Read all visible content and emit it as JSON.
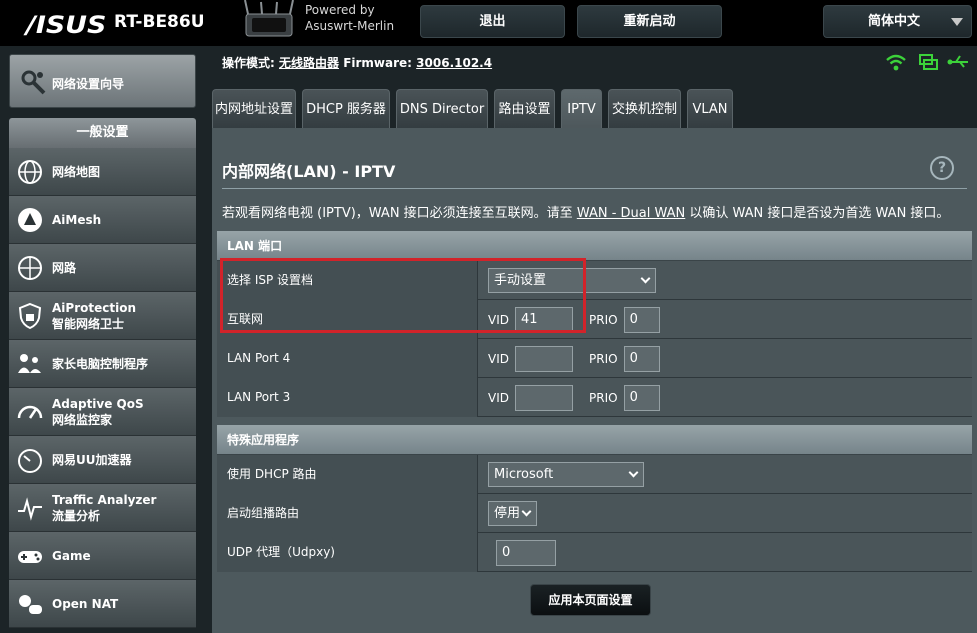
{
  "header": {
    "brand": "/ISUS",
    "model": "RT-BE86U",
    "powered_by_line1": "Powered by",
    "powered_by_line2": "Asuswrt-Merlin",
    "logout_label": "退出",
    "reboot_label": "重新启动",
    "language": "简体中文"
  },
  "sidebar": {
    "wizard_label": "网络设置向导",
    "general_header": "一般设置",
    "items": [
      {
        "label": "网络地图",
        "icon": "globe-map-icon"
      },
      {
        "label": "AiMesh",
        "icon": "aimesh-icon"
      },
      {
        "label": "网路",
        "icon": "network-icon"
      },
      {
        "label": "AiProtection",
        "sublabel": "智能网络卫士",
        "icon": "shield-lock-icon"
      },
      {
        "label": "家长电脑控制程序",
        "icon": "family-icon"
      },
      {
        "label": "Adaptive QoS",
        "sublabel": "网络监控家",
        "icon": "speedometer-icon"
      },
      {
        "label": "网易UU加速器",
        "icon": "gauge-icon"
      },
      {
        "label": "Traffic Analyzer",
        "sublabel": "流量分析",
        "icon": "traffic-icon"
      },
      {
        "label": "Game",
        "icon": "gamepad-icon"
      },
      {
        "label": "Open NAT",
        "icon": "open-nat-icon"
      }
    ]
  },
  "status": {
    "opmode_label": "操作模式:",
    "opmode_value": "无线路由器",
    "firmware_label": "Firmware:",
    "firmware_value": "3006.102.4"
  },
  "tabs": [
    {
      "label": "内网地址设置",
      "active": false
    },
    {
      "label": "DHCP 服务器",
      "active": false
    },
    {
      "label": "DNS Director",
      "active": false
    },
    {
      "label": "路由设置",
      "active": false
    },
    {
      "label": "IPTV",
      "active": true
    },
    {
      "label": "交换机控制",
      "active": false
    },
    {
      "label": "VLAN",
      "active": false
    }
  ],
  "page": {
    "title": "内部网络(LAN) - IPTV",
    "help": "?",
    "desc_before": "若观看网络电视 (IPTV)，WAN 接口必须连接至互联网。请至 ",
    "desc_link": "WAN - Dual WAN",
    "desc_after": " 以确认 WAN 接口是否设为首选 WAN 接口。",
    "apply_label": "应用本页面设置"
  },
  "lan_port_section": {
    "header": "LAN 端口",
    "isp_label": "选择 ISP 设置档",
    "isp_value": "手动设置",
    "vid_label": "VID",
    "prio_label": "PRIO",
    "rows": [
      {
        "label": "互联网",
        "vid": "41",
        "prio": "0"
      },
      {
        "label": "LAN Port 4",
        "vid": "",
        "prio": "0"
      },
      {
        "label": "LAN Port 3",
        "vid": "",
        "prio": "0"
      }
    ]
  },
  "special_section": {
    "header": "特殊应用程序",
    "dhcp_label": "使用 DHCP 路由",
    "dhcp_value": "Microsoft",
    "multicast_label": "启动组播路由",
    "multicast_value": "停用",
    "udpxy_label": "UDP 代理（Udpxy)",
    "udpxy_value": "0"
  },
  "colors": {
    "highlight": "#d2232a",
    "wifi_green": "#3cd23a",
    "panel": "#4d595d"
  }
}
